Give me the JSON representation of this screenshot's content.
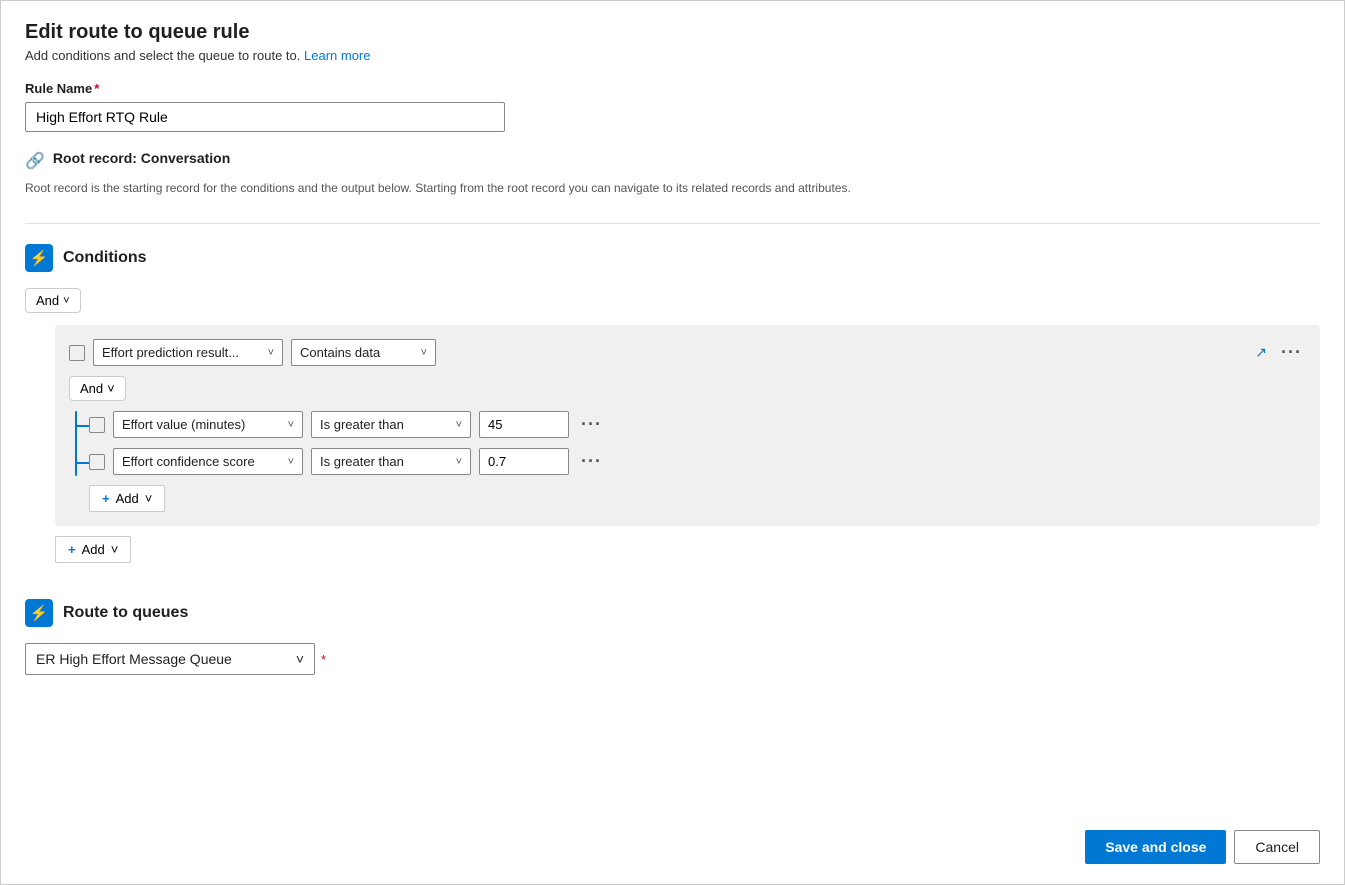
{
  "page": {
    "title": "Edit route to queue rule",
    "subtitle": "Add conditions and select the queue to route to.",
    "learn_more": "Learn more",
    "rule_name_label": "Rule Name",
    "rule_name_value": "High Effort RTQ Rule",
    "rule_name_placeholder": "High Effort RTQ Rule",
    "root_record_label": "Root record: Conversation",
    "root_record_desc": "Root record is the starting record for the conditions and the output below. Starting from the root record you can navigate to its related records and attributes.",
    "conditions_label": "Conditions",
    "and_label": "And",
    "route_queues_label": "Route to queues",
    "queue_value": "ER High Effort Message Queue"
  },
  "conditions": {
    "outer_and": "And",
    "group1": {
      "field1": "Effort prediction result...",
      "op1": "Contains data",
      "inner_and": "And",
      "rows": [
        {
          "field": "Effort value (minutes)",
          "op": "Is greater than",
          "value": "45"
        },
        {
          "field": "Effort confidence score",
          "op": "Is greater than",
          "value": "0.7"
        }
      ],
      "add_label": "+ Add"
    },
    "outer_add_label": "+ Add"
  },
  "footer": {
    "save_close": "Save and close",
    "cancel": "Cancel"
  },
  "icons": {
    "root_record": "🔗",
    "section_conditions": "⚡",
    "section_route": "⚡",
    "chevron_down": "˅",
    "expand": "↗",
    "collapse": "↙",
    "more": "···",
    "plus": "+"
  }
}
